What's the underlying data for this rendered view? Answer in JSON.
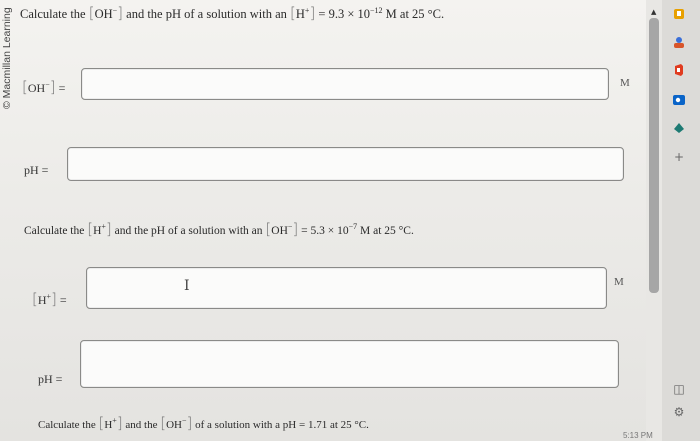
{
  "watermark": "© Macmillan Learning",
  "q1": {
    "pre": "Calculate the",
    "oh": "OH",
    "mid": "and the pH of a solution with an",
    "h": "H",
    "eq": "= 9.3 × 10",
    "exp": "−12",
    "post": "M at 25 °C."
  },
  "field1": {
    "label": "OH",
    "unit": "M"
  },
  "field2": {
    "label": "pH ="
  },
  "q2": {
    "pre": "Calculate the",
    "h": "H",
    "mid": "and the pH of a solution with an",
    "oh": "OH",
    "eq": "= 5.3 × 10",
    "exp": "−7",
    "post": "M at 25 °C."
  },
  "field3": {
    "label": "H",
    "unit": "M",
    "cursor": "I"
  },
  "field4": {
    "label": "pH ="
  },
  "q3": {
    "pre": "Calculate the",
    "h": "H",
    "mid": "and the",
    "oh": "OH",
    "post": "of a solution with a pH = 1.71 at 25 °C."
  },
  "sidebar": {
    "icons": [
      "bookmark-icon",
      "person-icon",
      "office-icon",
      "outlook-icon",
      "cloud-icon",
      "plus-icon",
      "sidebar-toggle-icon",
      "settings-icon"
    ],
    "glyphs": {
      "plus": "+",
      "settings": "⚙",
      "toggle": "◫"
    }
  },
  "clock": "5:13 PM"
}
